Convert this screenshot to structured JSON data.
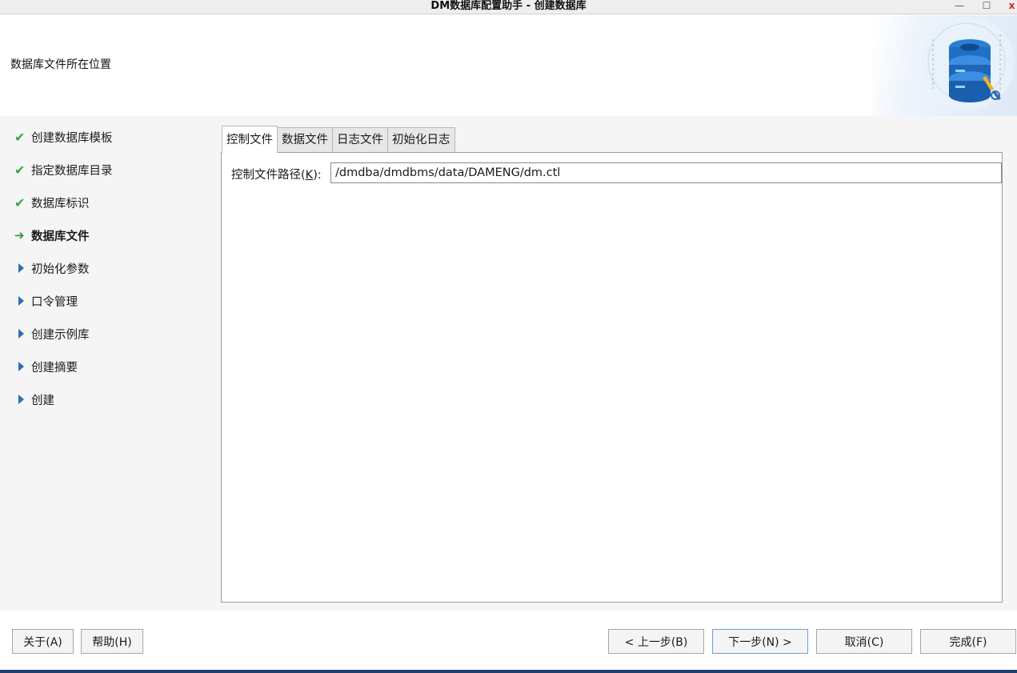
{
  "window": {
    "title": "DM数据库配置助手 - 创建数据库",
    "min_glyph": "—",
    "max_glyph": "☐",
    "close_glyph": "x"
  },
  "header": {
    "subtitle": "数据库文件所在位置",
    "art_icon": "database-wrench-icon"
  },
  "nav": {
    "items": [
      {
        "label": "创建数据库模板",
        "state": "done"
      },
      {
        "label": "指定数据库目录",
        "state": "done"
      },
      {
        "label": "数据库标识",
        "state": "done"
      },
      {
        "label": "数据库文件",
        "state": "current"
      },
      {
        "label": "初始化参数",
        "state": "pending"
      },
      {
        "label": "口令管理",
        "state": "pending"
      },
      {
        "label": "创建示例库",
        "state": "pending"
      },
      {
        "label": "创建摘要",
        "state": "pending"
      },
      {
        "label": "创建",
        "state": "pending"
      }
    ],
    "icons": {
      "done": "check-icon",
      "current": "arrow-right-icon",
      "pending": "triangle-right-icon"
    },
    "colors": {
      "done": "#3aa53a",
      "current": "#2e9a2e",
      "pending": "#2f6fb4"
    }
  },
  "tabs": {
    "items": [
      {
        "label": "控制文件",
        "active": true
      },
      {
        "label": "数据文件",
        "active": false
      },
      {
        "label": "日志文件",
        "active": false
      },
      {
        "label": "初始化日志",
        "active": false
      }
    ]
  },
  "control_file": {
    "label_prefix": "控制文件路径(",
    "label_mnemonic": "K",
    "label_suffix": "):",
    "path_value": "/dmdba/dmdbms/data/DAMENG/dm.ctl"
  },
  "footer": {
    "about": "关于(A)",
    "help": "帮助(H)",
    "back": "< 上一步(B)",
    "next": "下一步(N) >",
    "cancel": "取消(C)",
    "finish": "完成(F)"
  }
}
